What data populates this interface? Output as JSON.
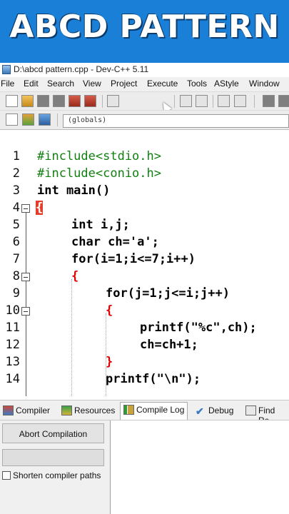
{
  "banner": {
    "title": "ABCD PATTERN"
  },
  "window": {
    "title": "D:\\abcd pattern.cpp - Dev-C++ 5.11"
  },
  "menu": [
    "File",
    "Edit",
    "Search",
    "View",
    "Project",
    "Execute",
    "Tools",
    "AStyle",
    "Window"
  ],
  "toolbar": {
    "scope_value": "(globals)"
  },
  "editor": {
    "lines": [
      {
        "n": "1",
        "code": "#include<stdio.h>"
      },
      {
        "n": "2",
        "code": "#include<conio.h>"
      },
      {
        "n": "3",
        "code": "int main()"
      },
      {
        "n": "4",
        "code": "{"
      },
      {
        "n": "5",
        "code": "int i,j;"
      },
      {
        "n": "6",
        "code": "char ch='a';"
      },
      {
        "n": "7",
        "code": "for(i=1;i<=7;i++)"
      },
      {
        "n": "8",
        "code": "{"
      },
      {
        "n": "9",
        "code": "for(j=1;j<=i;j++)"
      },
      {
        "n": "10",
        "code": "{"
      },
      {
        "n": "11",
        "code": "printf(\"%c\",ch);"
      },
      {
        "n": "12",
        "code": "ch=ch+1;"
      },
      {
        "n": "13",
        "code": "}"
      },
      {
        "n": "14",
        "code": "printf(\"\\n\");"
      }
    ]
  },
  "bottom_tabs": [
    "Compiler",
    "Resources",
    "Compile Log",
    "Debug",
    "Find Re"
  ],
  "active_tab": "Compile Log",
  "panel": {
    "abort_label": "Abort Compilation",
    "shorten_label": "Shorten compiler paths"
  },
  "colors": {
    "banner": "#1a7fd6",
    "preprocessor": "#108010",
    "operator": "#e00000",
    "number": "#800080",
    "string": "#0000ff",
    "brace_highlight": "#e23e2a"
  }
}
